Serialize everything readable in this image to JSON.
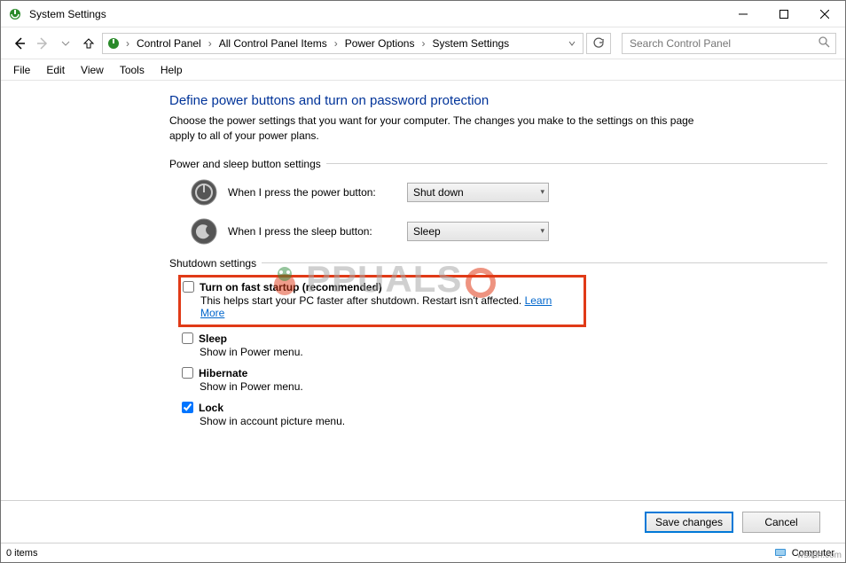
{
  "window": {
    "title": "System Settings"
  },
  "breadcrumb": {
    "items": [
      "Control Panel",
      "All Control Panel Items",
      "Power Options",
      "System Settings"
    ]
  },
  "search": {
    "placeholder": "Search Control Panel"
  },
  "menu": {
    "items": [
      "File",
      "Edit",
      "View",
      "Tools",
      "Help"
    ]
  },
  "page": {
    "heading": "Define power buttons and turn on password protection",
    "description": "Choose the power settings that you want for your computer. The changes you make to the settings on this page apply to all of your power plans.",
    "section1": "Power and sleep button settings",
    "power_button_label": "When I press the power button:",
    "power_button_value": "Shut down",
    "sleep_button_label": "When I press the sleep button:",
    "sleep_button_value": "Sleep",
    "section2": "Shutdown settings",
    "fast_startup": {
      "title": "Turn on fast startup (recommended)",
      "sub": "This helps start your PC faster after shutdown. Restart isn't affected. ",
      "link": "Learn More"
    },
    "sleep": {
      "title": "Sleep",
      "sub": "Show in Power menu."
    },
    "hibernate": {
      "title": "Hibernate",
      "sub": "Show in Power menu."
    },
    "lock": {
      "title": "Lock",
      "sub": "Show in account picture menu."
    }
  },
  "buttons": {
    "save": "Save changes",
    "cancel": "Cancel"
  },
  "status": {
    "left": "0 items",
    "right": "Computer"
  },
  "watermark": "PPUALS",
  "source": "wsxdn.com"
}
